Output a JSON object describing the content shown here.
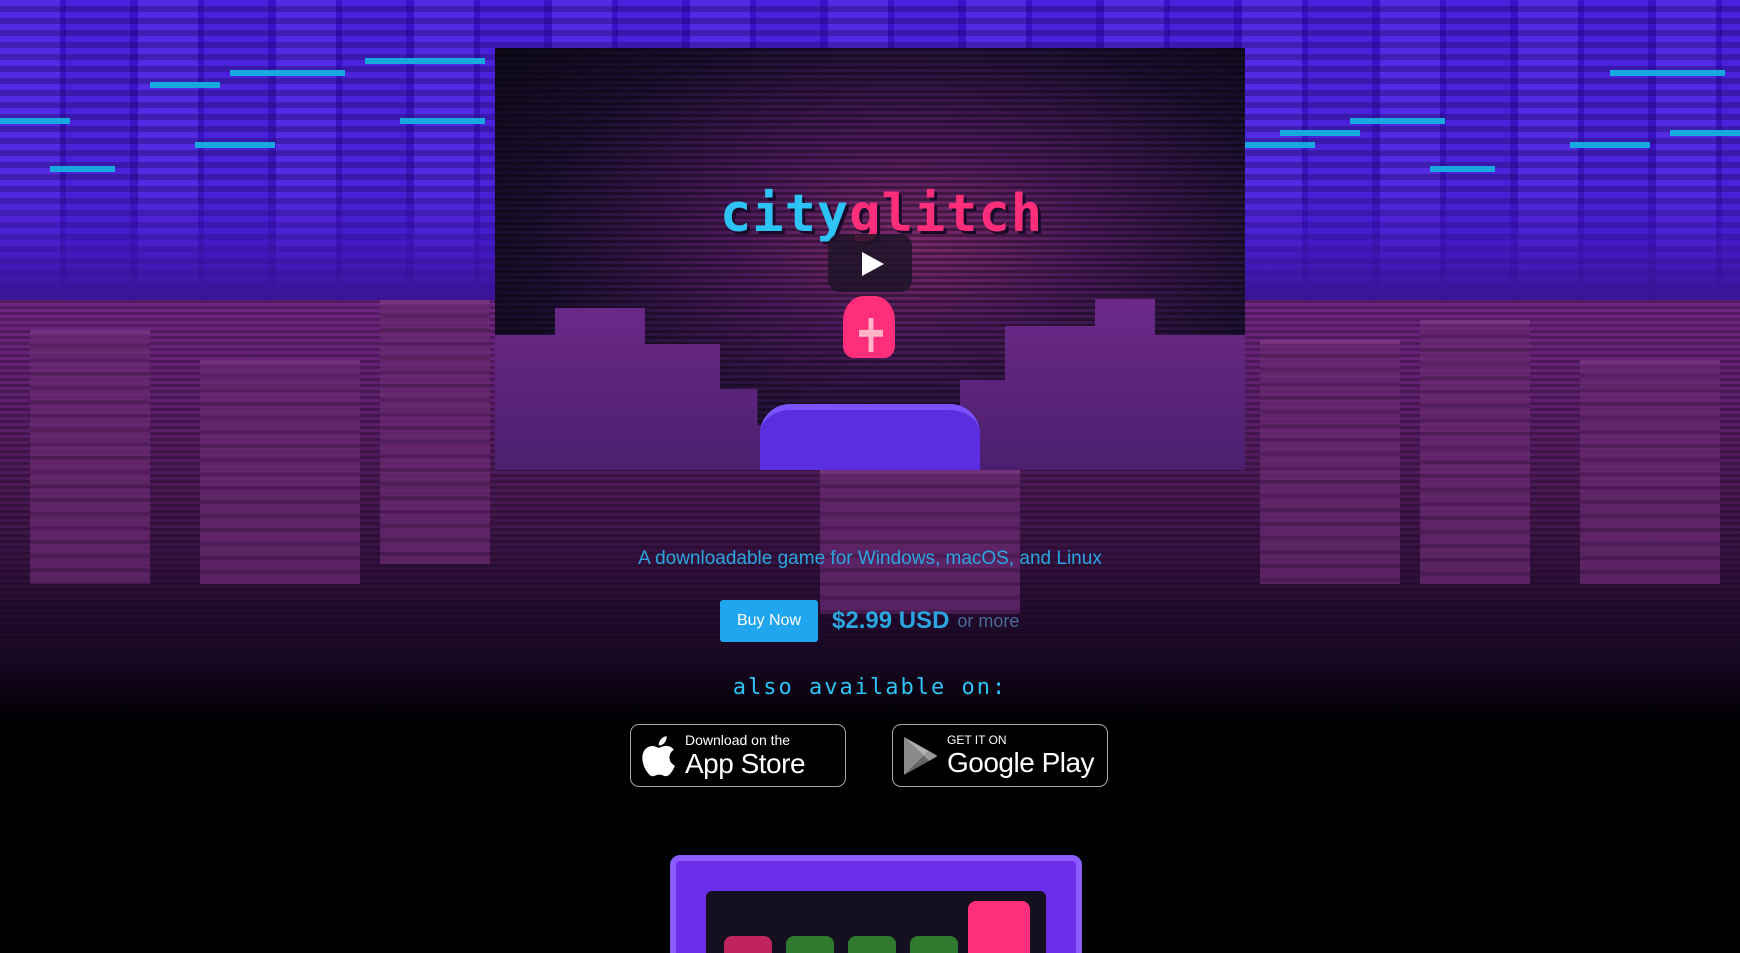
{
  "video": {
    "title_part1": "city",
    "title_part2": "glitch"
  },
  "tagline": "A downloadable game for Windows, macOS, and Linux",
  "purchase": {
    "buy_label": "Buy Now",
    "price": "$2.99 USD",
    "price_suffix": "or more"
  },
  "also_available": "also available on:",
  "stores": {
    "app_store": {
      "small": "Download on the",
      "big": "App Store"
    },
    "google_play": {
      "small": "GET IT ON",
      "big": "Google Play"
    }
  },
  "colors": {
    "accent_cyan": "#2ba6e0",
    "buy_button": "#1fa6ef",
    "brand_pink": "#ff2e7a"
  }
}
